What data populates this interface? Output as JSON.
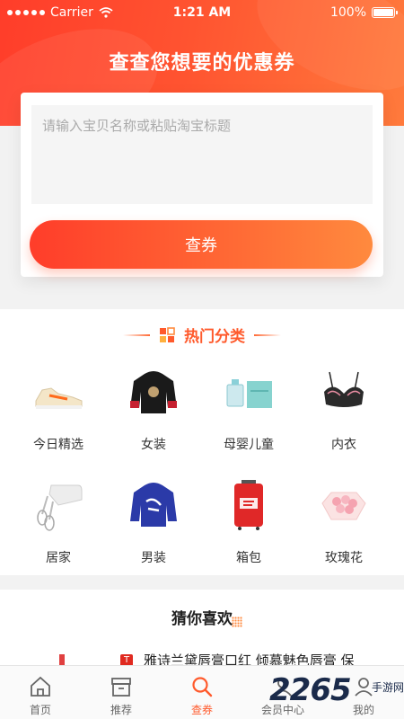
{
  "status_bar": {
    "carrier": "Carrier",
    "time": "1:21 AM",
    "battery": "100%"
  },
  "hero": {
    "title": "查查您想要的优惠券"
  },
  "search": {
    "placeholder": "请输入宝贝名称或粘贴淘宝标题",
    "value": "",
    "button_label": "查券"
  },
  "categories": {
    "title": "热门分类",
    "items": [
      {
        "label": "今日精选",
        "icon": "sneaker-icon"
      },
      {
        "label": "女装",
        "icon": "hoodie-icon"
      },
      {
        "label": "母婴儿童",
        "icon": "perfume-box-icon"
      },
      {
        "label": "内衣",
        "icon": "lingerie-icon"
      },
      {
        "label": "居家",
        "icon": "hand-mixer-icon"
      },
      {
        "label": "男装",
        "icon": "blue-hoodie-icon"
      },
      {
        "label": "箱包",
        "icon": "suitcase-icon"
      },
      {
        "label": "玫瑰花",
        "icon": "rose-box-icon"
      }
    ]
  },
  "guess": {
    "title": "猜你喜欢",
    "products": [
      {
        "title": "雅诗兰黛唇膏口红 倾慕魅色唇膏 保",
        "badge_icon": "tmall-icon"
      }
    ]
  },
  "tabbar": {
    "items": [
      {
        "label": "首页",
        "icon": "home-icon",
        "active": false
      },
      {
        "label": "推荐",
        "icon": "archive-icon",
        "active": false
      },
      {
        "label": "查券",
        "icon": "search-icon",
        "active": true
      },
      {
        "label": "会员中心",
        "icon": "member-icon",
        "active": false
      },
      {
        "label": "我的",
        "icon": "user-icon",
        "active": false
      }
    ]
  },
  "watermark": {
    "number": "2265",
    "text": "手游网"
  },
  "colors": {
    "accent": "#ff5a2c",
    "gradient_start": "#ff3d2a",
    "gradient_end": "#ff8a3e"
  }
}
